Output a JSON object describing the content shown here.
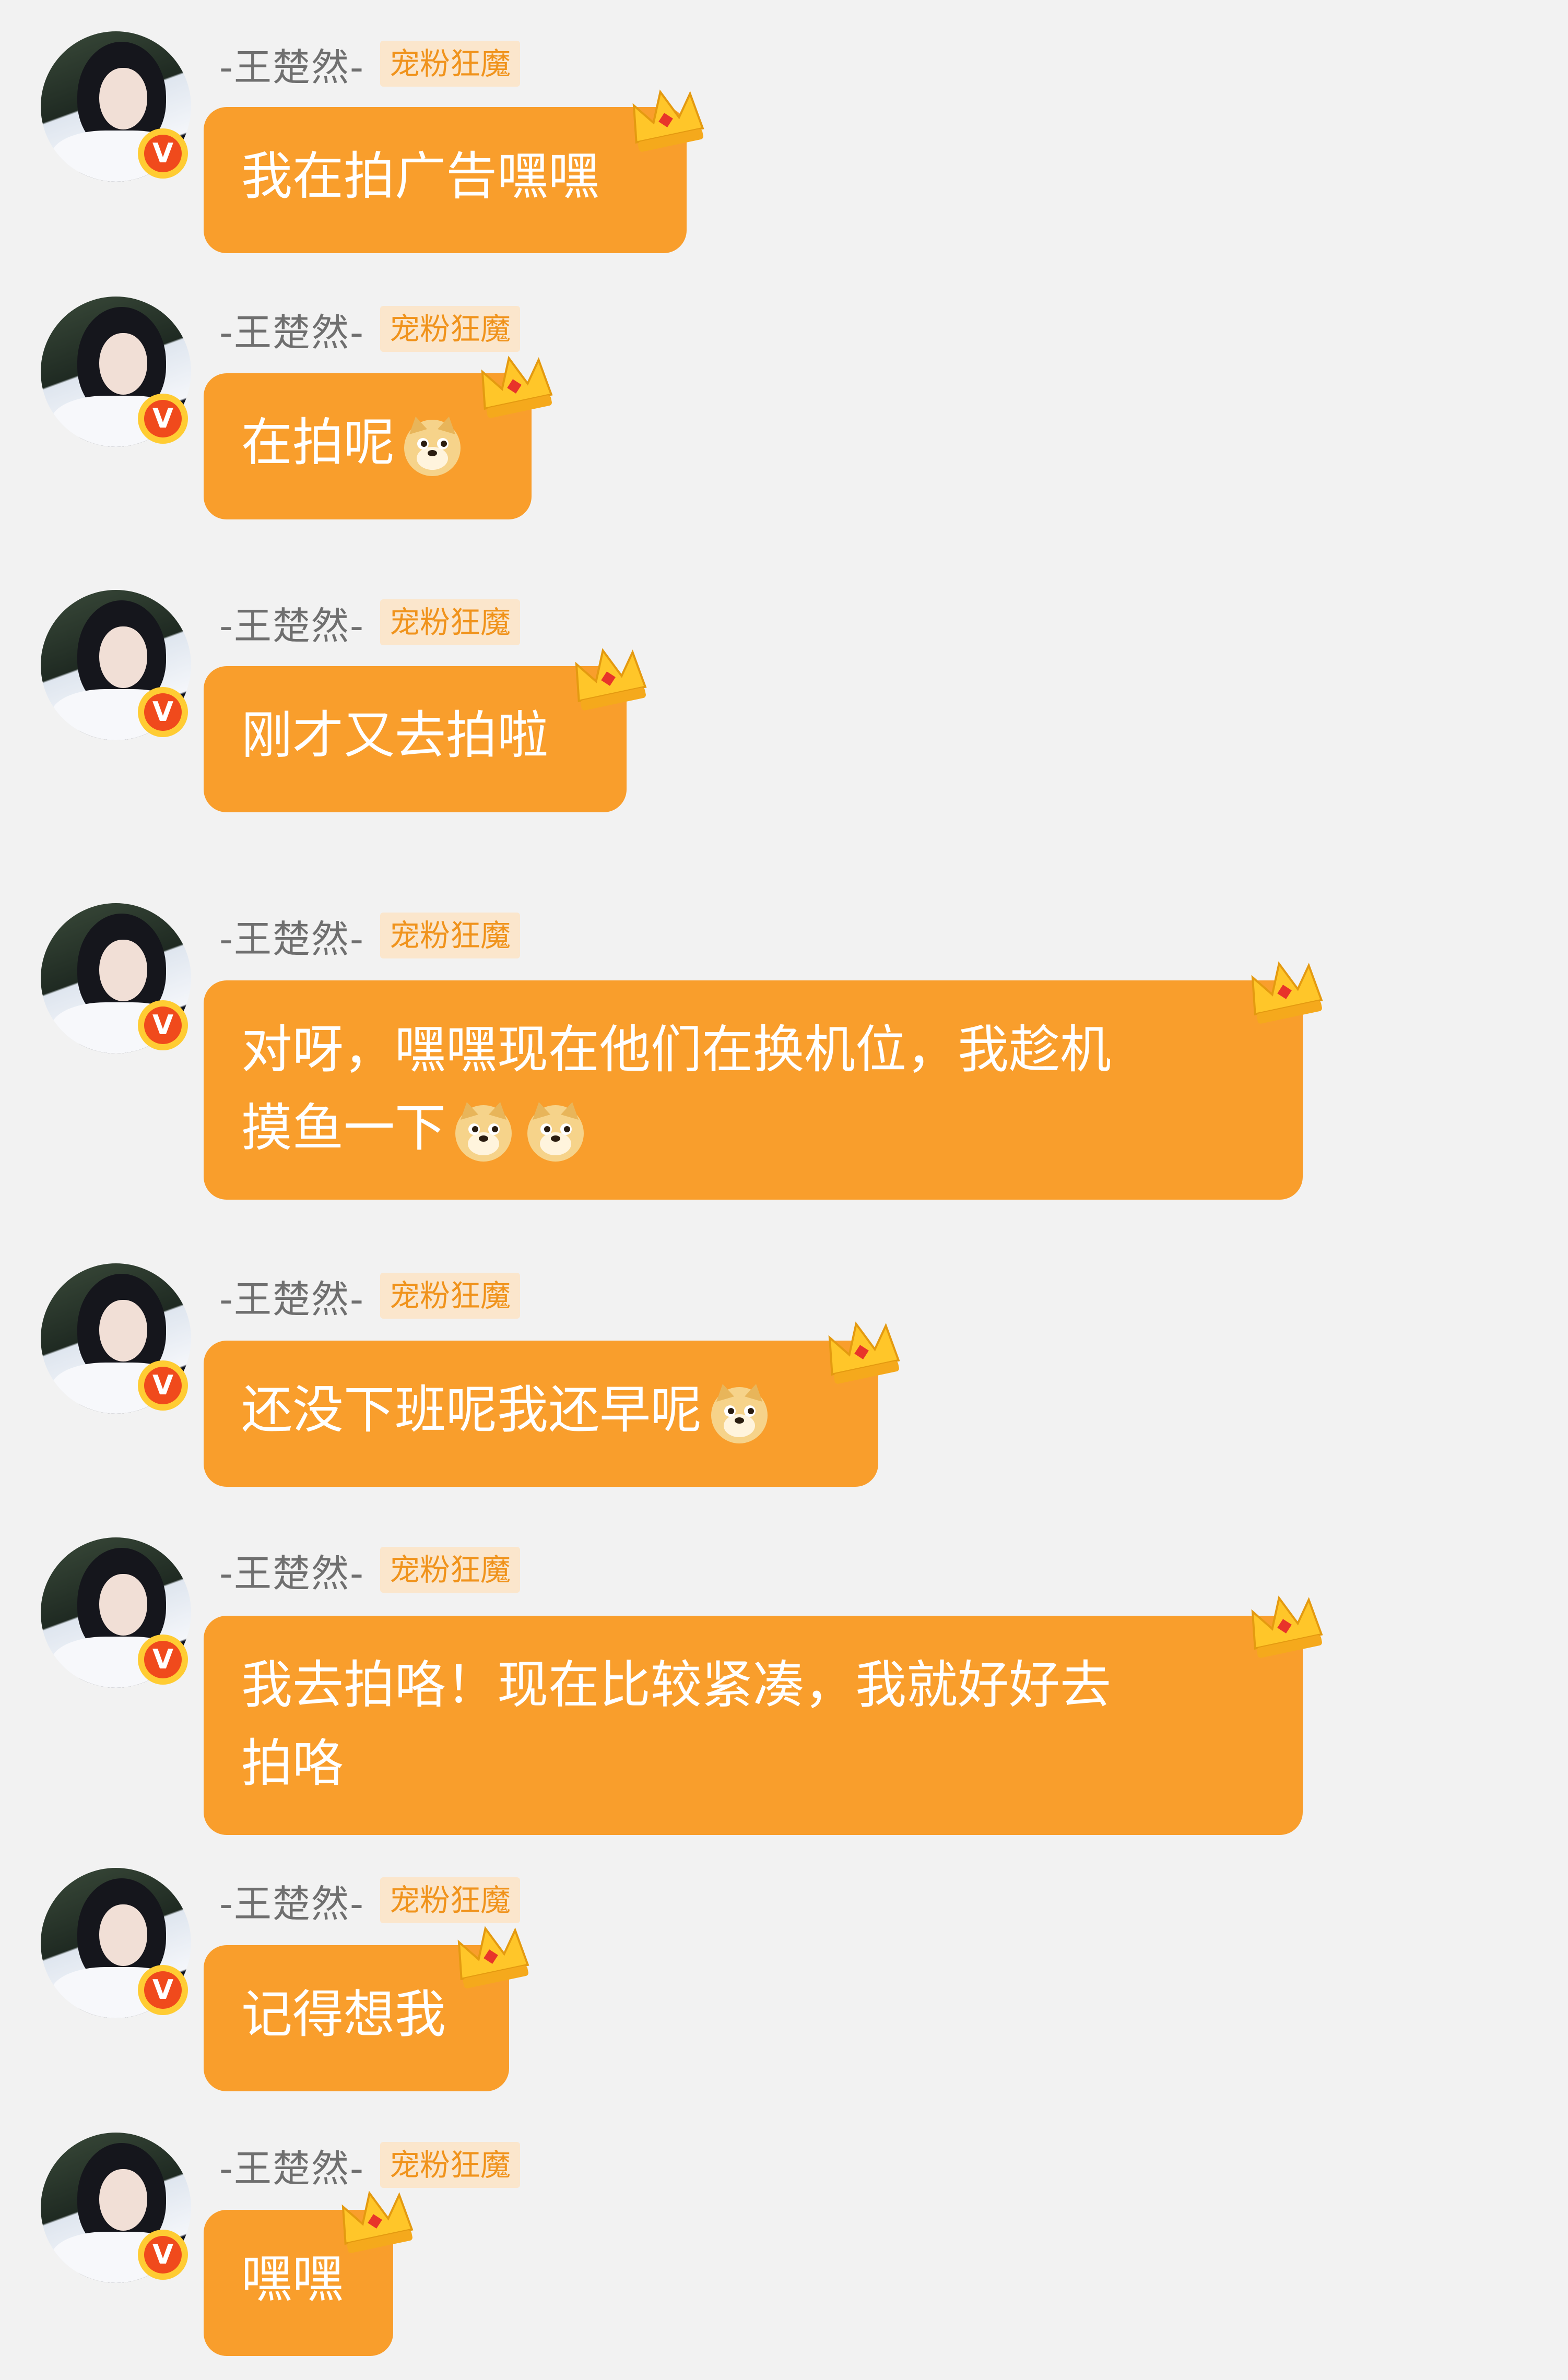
{
  "sender": {
    "name": "-王楚然-",
    "badge": "宠粉狂魔",
    "verified_mark": "V"
  },
  "colors": {
    "background": "#f2f2f2",
    "bubble": "#f99e2c",
    "badge_bg": "#fbe6cc",
    "badge_text": "#f0931c",
    "name_text": "#6f6f6f"
  },
  "messages": [
    {
      "text": "我在拍广告嘿嘿",
      "emojis": []
    },
    {
      "text": "在拍呢",
      "emojis": [
        "doge-emoji"
      ]
    },
    {
      "text": "刚才又去拍啦",
      "emojis": []
    },
    {
      "text": "对呀，嘿嘿现在他们在换机位，我趁机\n摸鱼一下",
      "emojis": [
        "doge-emoji",
        "doge-emoji"
      ]
    },
    {
      "text": "还没下班呢我还早呢",
      "emojis": [
        "doge-emoji"
      ]
    },
    {
      "text": "我去拍咯！现在比较紧凑，我就好好去\n拍咯",
      "emojis": []
    },
    {
      "text": "记得想我",
      "emojis": []
    },
    {
      "text": "嘿嘿",
      "emojis": []
    }
  ],
  "icons": {
    "avatar": "avatar",
    "verified": "verified-v-icon",
    "crown": "crown-icon",
    "emoji": "doge-emoji"
  }
}
